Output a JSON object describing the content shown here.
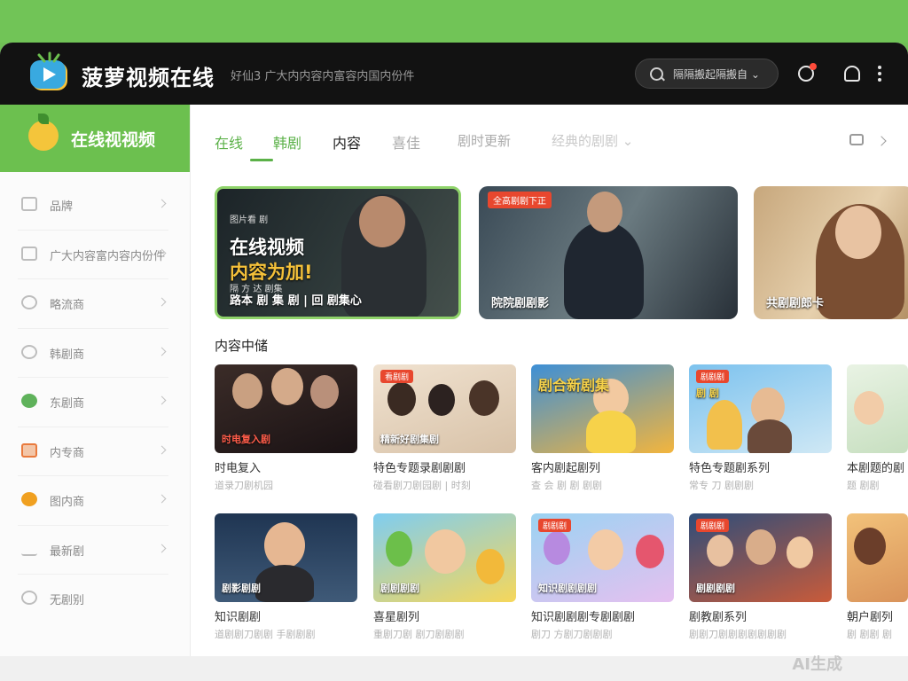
{
  "app": {
    "title": "菠萝视频在线",
    "tagline": "好仙3 广大内内容内富容内国内份件"
  },
  "search": {
    "placeholder": "隔隔搬起隔搬自 ⌄"
  },
  "sidebar": {
    "title": "在线视视频",
    "items": [
      {
        "label": "品牌",
        "icon": "monitor-icon"
      },
      {
        "label": "广大内容富内容内份件",
        "icon": "tv-icon"
      },
      {
        "label": "略流商",
        "icon": "community-icon"
      },
      {
        "label": "韩剧商",
        "icon": "drama-icon"
      },
      {
        "label": "东剧商",
        "icon": "globe-icon"
      },
      {
        "label": "内专商",
        "icon": "film-icon"
      },
      {
        "label": "图内商",
        "icon": "note-icon"
      },
      {
        "label": "最新剧",
        "icon": "new-icon"
      },
      {
        "label": "无剧别",
        "icon": "chat-icon"
      }
    ]
  },
  "tabs": [
    {
      "label": "在线",
      "state": "active"
    },
    {
      "label": "韩剧",
      "state": "active"
    },
    {
      "label": "内容",
      "state": "bold"
    },
    {
      "label": "喜佳",
      "state": "muted"
    },
    {
      "label": "剧时更新",
      "state": "muted"
    },
    {
      "label": "经典的剧剧 ⌄",
      "state": "muted"
    }
  ],
  "hero": [
    {
      "top_text": "图片看 剧",
      "line1": "在线视频",
      "line2": "内容为加!",
      "small": "隔 方 达 剧集",
      "bottom": "路本 剧 集 剧  | 回 剧集心"
    },
    {
      "badge": "全高剧剧下正",
      "bottom": "院院剧剧影"
    },
    {
      "bottom": "共剧剧郎卡"
    }
  ],
  "section": {
    "title": "内容中储"
  },
  "cards_row1": [
    {
      "thumb_text": "时电复入剧",
      "badge": "",
      "title": "时电复入",
      "sub": "道录刀剧机园"
    },
    {
      "thumb_text": "精新好剧集剧",
      "badge": "看剧剧",
      "title": "特色专题录剧剧剧",
      "sub": "碰看剧刀剧园剧 | 时刻"
    },
    {
      "thumb_text": "剧合新剧集",
      "badge": "",
      "title": "客内剧起剧列",
      "sub": "查 会 剧 剧 剧剧"
    },
    {
      "thumb_text": "剧 剧",
      "badge": "剧剧剧",
      "title": "特色专题剧系列",
      "sub": "常专 刀 剧剧剧"
    },
    {
      "thumb_text": "",
      "badge": "",
      "title": "本剧题的剧",
      "sub": "题 剧剧"
    }
  ],
  "cards_row2": [
    {
      "thumb_text": "剧影剧剧",
      "badge": "",
      "title": "知识剧剧",
      "sub": "道剧剧刀剧剧 手剧剧剧"
    },
    {
      "thumb_text": "剧剧剧剧",
      "badge": "",
      "title": "喜星剧列",
      "sub": "重剧刀剧 剧刀剧剧剧"
    },
    {
      "thumb_text": "知识剧剧剧剧",
      "badge": "剧剧剧",
      "title": "知识剧剧剧专剧剧剧",
      "sub": "剧刀 方剧刀剧剧剧"
    },
    {
      "thumb_text": "剧剧剧剧",
      "badge": "剧剧剧",
      "title": "剧教剧系列",
      "sub": "剧剧刀剧剧剧剧剧剧剧"
    },
    {
      "thumb_text": "",
      "badge": "",
      "title": "朝户剧列",
      "sub": "剧 剧剧 剧"
    }
  ],
  "watermark": "AI生成",
  "colors": {
    "accent": "#5bb148",
    "header": "#121212",
    "badge": "#e8472e"
  }
}
